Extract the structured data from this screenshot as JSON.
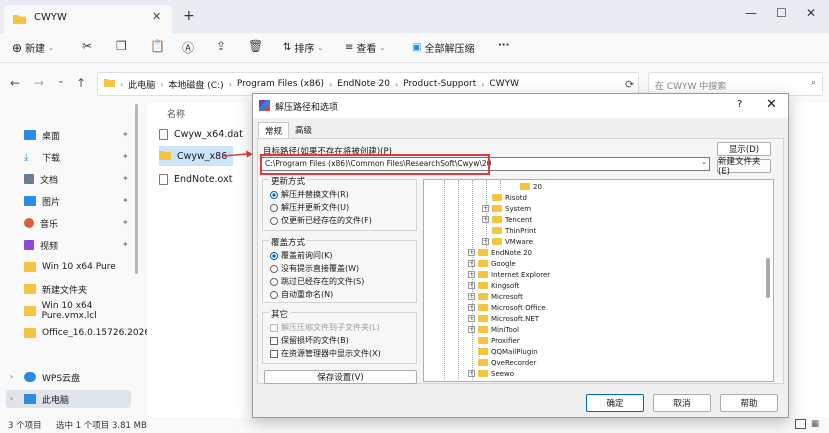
{
  "explorer": {
    "tab_title": "CWYW",
    "toolbar": {
      "new": "新建",
      "sort": "排序",
      "view": "查看",
      "extract_all": "全部解压缩",
      "more": "···"
    },
    "breadcrumb": [
      "此电脑",
      "本地磁盘 (C:)",
      "Program Files (x86)",
      "EndNote 20",
      "Product-Support",
      "CWYW"
    ],
    "search_placeholder": "在 CWYW 中搜索",
    "sidebar": [
      {
        "label": "桌面",
        "icon": "desktop-icon",
        "color": "#2b8ce8",
        "pinned": true
      },
      {
        "label": "下载",
        "icon": "download-icon",
        "color": "#2b8ce8",
        "pinned": true
      },
      {
        "label": "文档",
        "icon": "documents-icon",
        "color": "#6b7c93",
        "pinned": true
      },
      {
        "label": "图片",
        "icon": "pictures-icon",
        "color": "#2b8ce8",
        "pinned": true
      },
      {
        "label": "音乐",
        "icon": "music-icon",
        "color": "#e15a3a",
        "pinned": true
      },
      {
        "label": "视频",
        "icon": "videos-icon",
        "color": "#8d4ad8",
        "pinned": true
      },
      {
        "label": "Win 10 x64 Pure",
        "icon": "folder-icon",
        "color": "#f5c542"
      },
      {
        "label": "新建文件夹",
        "icon": "folder-icon",
        "color": "#f5c542"
      },
      {
        "label": "Win 10 x64 Pure.vmx.lcl",
        "icon": "folder-icon",
        "color": "#f5c542"
      },
      {
        "label": "Office_16.0.15726.2026",
        "icon": "folder-icon",
        "color": "#f5c542"
      },
      {
        "label": "WPS云盘",
        "icon": "cloud-icon",
        "color": "#2b8ce8"
      },
      {
        "label": "此电脑",
        "icon": "computer-icon",
        "color": "#2b8ce8"
      }
    ],
    "column_name": "名称",
    "files": [
      {
        "name": "Cwyw_x64.dat",
        "type": "doc"
      },
      {
        "name": "Cwyw_x86",
        "type": "folder",
        "selected": true
      },
      {
        "name": "EndNote.oxt",
        "type": "doc"
      }
    ],
    "status": {
      "count": "3 个项目",
      "selected": "选中 1 个项目  3.81 MB"
    }
  },
  "dialog": {
    "title": "解压路径和选项",
    "help_q": "?",
    "tabs": [
      "常规",
      "高级"
    ],
    "target_label": "目标路径(如果不存在将被创建)(P)",
    "target_value": "C:\\Program Files (x86)\\Common Files\\ResearchSoft\\Cwyw\\20",
    "show_button": "显示(D)",
    "new_folder_button": "新建文件夹(E)",
    "update_mode": {
      "title": "更新方式",
      "options": [
        {
          "label": "解压并替换文件(R)",
          "checked": true
        },
        {
          "label": "解压并更新文件(U)",
          "checked": false
        },
        {
          "label": "仅更新已经存在的文件(F)",
          "checked": false
        }
      ]
    },
    "overwrite_mode": {
      "title": "覆盖方式",
      "options": [
        {
          "label": "覆盖前询问(K)",
          "checked": true
        },
        {
          "label": "没有提示直接覆盖(W)",
          "checked": false
        },
        {
          "label": "跳过已经存在的文件(S)",
          "checked": false
        },
        {
          "label": "自动重命名(N)",
          "checked": false
        }
      ]
    },
    "misc": {
      "title": "其它",
      "options": [
        {
          "label": "解压压缩文件到子文件夹(L)",
          "disabled": true
        },
        {
          "label": "保留损坏的文件(B)",
          "disabled": false
        },
        {
          "label": "在资源管理器中显示文件(X)",
          "disabled": false
        }
      ]
    },
    "save_settings": "保存设置(V)",
    "tree": [
      {
        "label": "20",
        "level": 3,
        "expand": false
      },
      {
        "label": "Risotd",
        "level": 2,
        "expand": false
      },
      {
        "label": "System",
        "level": 2,
        "expand": true
      },
      {
        "label": "Tencent",
        "level": 2,
        "expand": true
      },
      {
        "label": "ThinPrint",
        "level": 2,
        "expand": false
      },
      {
        "label": "VMware",
        "level": 2,
        "expand": true
      },
      {
        "label": "EndNote 20",
        "level": 1,
        "expand": true
      },
      {
        "label": "Google",
        "level": 1,
        "expand": true
      },
      {
        "label": "Internet Explorer",
        "level": 1,
        "expand": true
      },
      {
        "label": "Kingsoft",
        "level": 1,
        "expand": true
      },
      {
        "label": "Microsoft",
        "level": 1,
        "expand": true
      },
      {
        "label": "Microsoft Office",
        "level": 1,
        "expand": true
      },
      {
        "label": "Microsoft.NET",
        "level": 1,
        "expand": true
      },
      {
        "label": "MiniTool",
        "level": 1,
        "expand": true
      },
      {
        "label": "Proxifier",
        "level": 1,
        "expand": false
      },
      {
        "label": "QQMailPlugin",
        "level": 1,
        "expand": false
      },
      {
        "label": "QveRecorder",
        "level": 1,
        "expand": false
      },
      {
        "label": "Seewo",
        "level": 1,
        "expand": true
      }
    ],
    "ok": "确定",
    "cancel": "取消",
    "help": "帮助"
  }
}
